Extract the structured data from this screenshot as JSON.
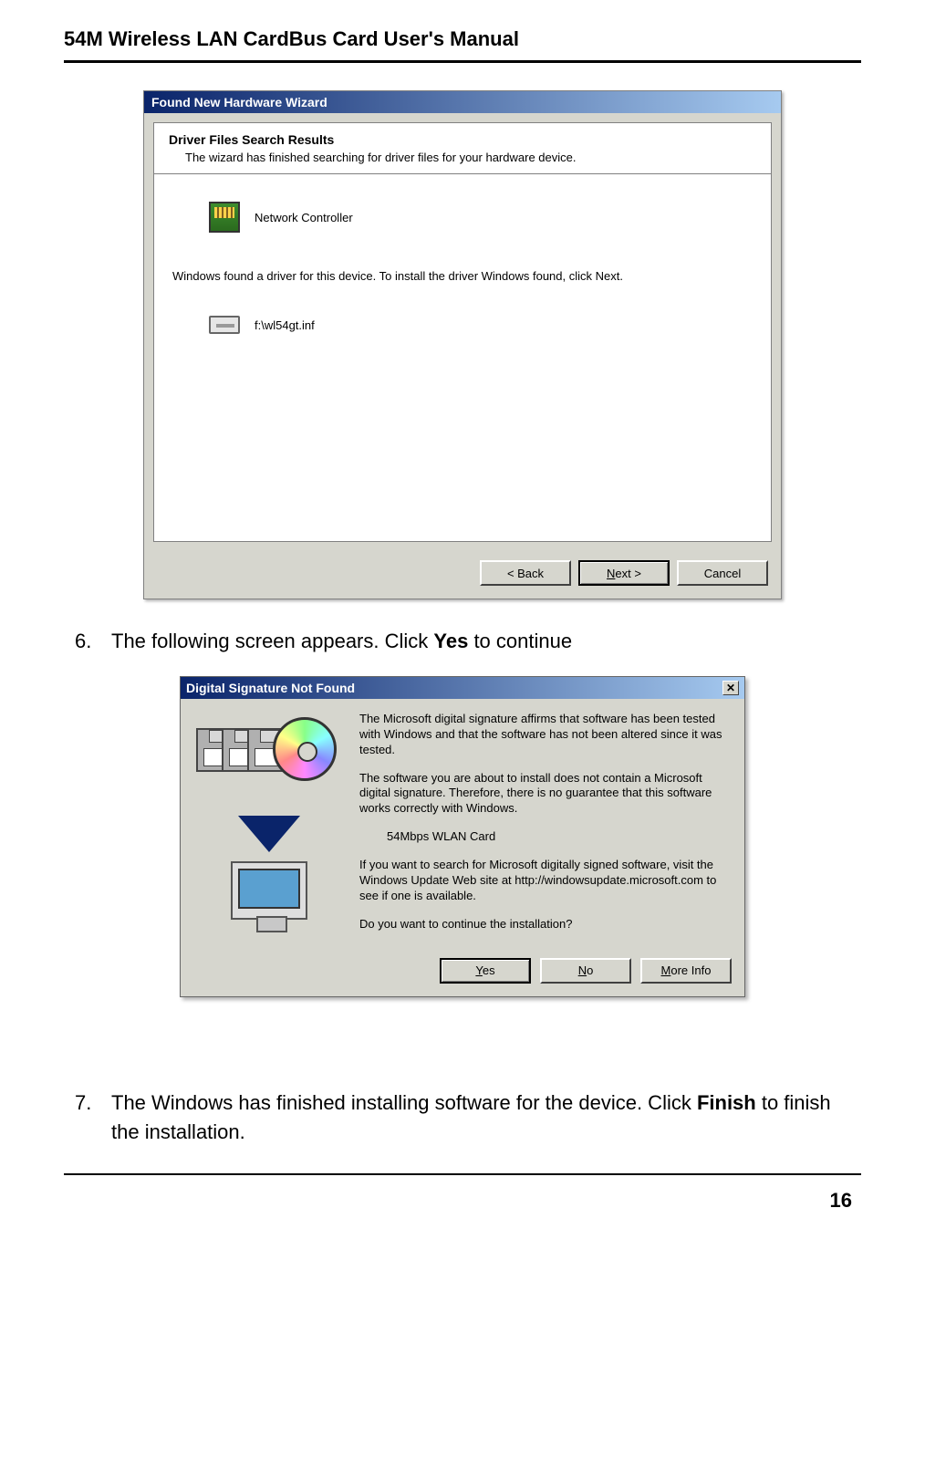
{
  "header": {
    "title": "54M Wireless LAN CardBus Card User's Manual"
  },
  "wizard": {
    "title": "Found New Hardware Wizard",
    "heading": "Driver Files Search Results",
    "subheading": "The wizard has finished searching for driver files for your hardware device.",
    "device_label": "Network Controller",
    "info": "Windows found a driver for this device. To install the driver Windows found, click Next.",
    "inf_path": "f:\\wl54gt.inf",
    "buttons": {
      "back": "< Back",
      "next": "Next >",
      "cancel": "Cancel"
    }
  },
  "step6": {
    "num": "6.",
    "prefix": "The following screen appears. Click ",
    "bold": "Yes",
    "suffix": " to continue"
  },
  "sig_dialog": {
    "title": "Digital Signature Not Found",
    "para1": "The Microsoft digital signature affirms that software has been tested with Windows and that the software has not been altered since it was tested.",
    "para2": "The software you are about to install does not contain a Microsoft digital signature. Therefore, there is no guarantee that this software works correctly with Windows.",
    "product": "54Mbps WLAN Card",
    "para3": "If you want to search for Microsoft digitally signed software, visit the Windows Update Web site at http://windowsupdate.microsoft.com to see if one is available.",
    "question": "Do you want to continue the installation?",
    "buttons": {
      "yes": "Yes",
      "no": "No",
      "more_info": "More Info"
    }
  },
  "step7": {
    "num": "7.",
    "prefix": "The Windows has finished installing software for the device. Click ",
    "bold": "Finish",
    "suffix": " to finish the installation."
  },
  "page_number": "16"
}
